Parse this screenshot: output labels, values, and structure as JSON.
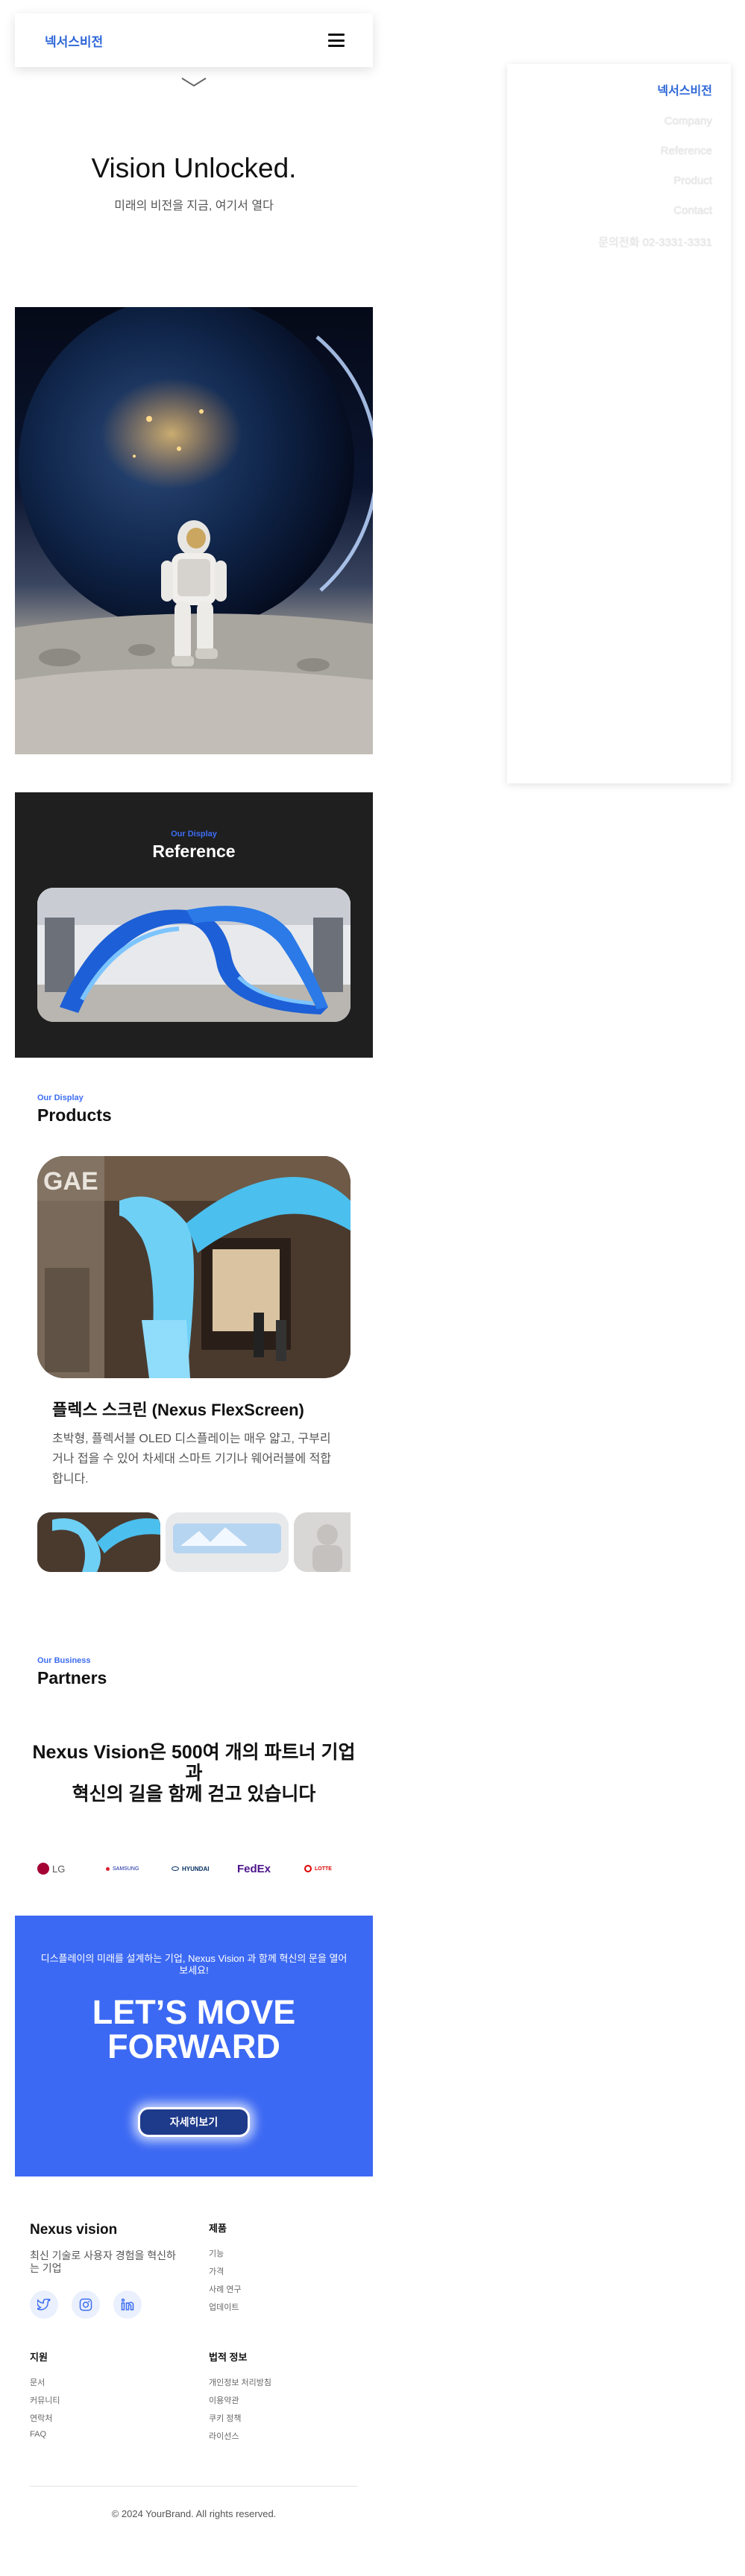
{
  "header": {
    "logo": "넥서스비전",
    "menu_icon": "hamburger-icon",
    "scroll_icon": "chevron-down-icon"
  },
  "hero": {
    "title": "Vision Unlocked.",
    "subtitle": "미래의 비전을 지금, 여기서 열다"
  },
  "reference": {
    "eyebrow": "Our Display",
    "title": "Reference"
  },
  "products": {
    "eyebrow": "Our Display",
    "title": "Products",
    "name": "플렉스 스크린 (Nexus FlexScreen)",
    "description": "초박형, 플렉서블 OLED 디스플레이는 매우 얇고, 구부리거나 접을 수 있어 차세대 스마트 기기나 웨어러블에 적합합니다."
  },
  "partners": {
    "eyebrow": "Our Business",
    "title": "Partners",
    "line1": "Nexus Vision은 500여 개의 파트너 기업과",
    "line2": "혁신의 길을 함께 걷고 있습니다",
    "logos": [
      "LG",
      "SAMSUNG",
      "HYUNDAI",
      "FedEx",
      "LOTTE"
    ]
  },
  "cta": {
    "text": "디스플레이의 미래를 설계하는 기업, Nexus Vision 과 함께 혁신의 문을 열어보세요!",
    "title_line1": "LET’S MOVE",
    "title_line2": "FORWARD",
    "button": "자세히보기"
  },
  "footer": {
    "brand": "Nexus vision",
    "tagline": "최신 기술로 사용자 경험을 혁신하는 기업",
    "social_icons": [
      "twitter-icon",
      "instagram-icon",
      "linkedin-icon"
    ],
    "product_heading": "제품",
    "product_links": [
      "기능",
      "가격",
      "사례 연구",
      "업데이트"
    ],
    "support_heading": "지원",
    "support_links": [
      "문서",
      "커뮤니티",
      "연락처",
      "FAQ"
    ],
    "legal_heading": "법적 정보",
    "legal_links": [
      "개인정보 처리방침",
      "이용약관",
      "쿠키 정책",
      "라이선스"
    ],
    "copyright": "© 2024 YourBrand. All rights reserved."
  },
  "side_menu": {
    "brand": "넥서스비전",
    "items": [
      "Company",
      "Reference",
      "Product",
      "Contact",
      "문의전화 02-3331-3331"
    ]
  },
  "colors": {
    "brand_blue": "#2e67d8",
    "accent_blue": "#3d6df2",
    "cta_blue": "#3c69f3",
    "dark_section": "#1f1f1f"
  }
}
